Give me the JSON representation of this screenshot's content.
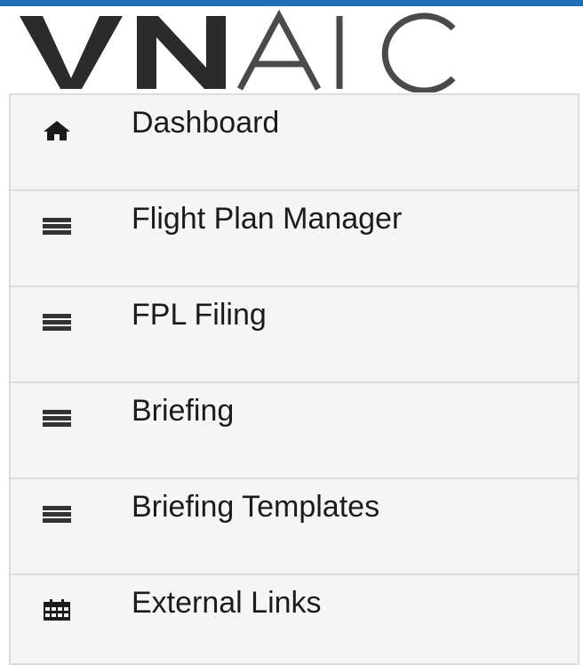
{
  "brand": {
    "logo_text": "VNAIC",
    "accent_color": "#1f6fb8"
  },
  "menu": {
    "items": [
      {
        "label": "Dashboard",
        "icon": "home-icon"
      },
      {
        "label": "Flight Plan Manager",
        "icon": "list-icon"
      },
      {
        "label": "FPL Filing",
        "icon": "list-icon"
      },
      {
        "label": "Briefing",
        "icon": "list-icon"
      },
      {
        "label": "Briefing Templates",
        "icon": "list-icon"
      },
      {
        "label": "External Links",
        "icon": "calendar-icon"
      }
    ]
  }
}
